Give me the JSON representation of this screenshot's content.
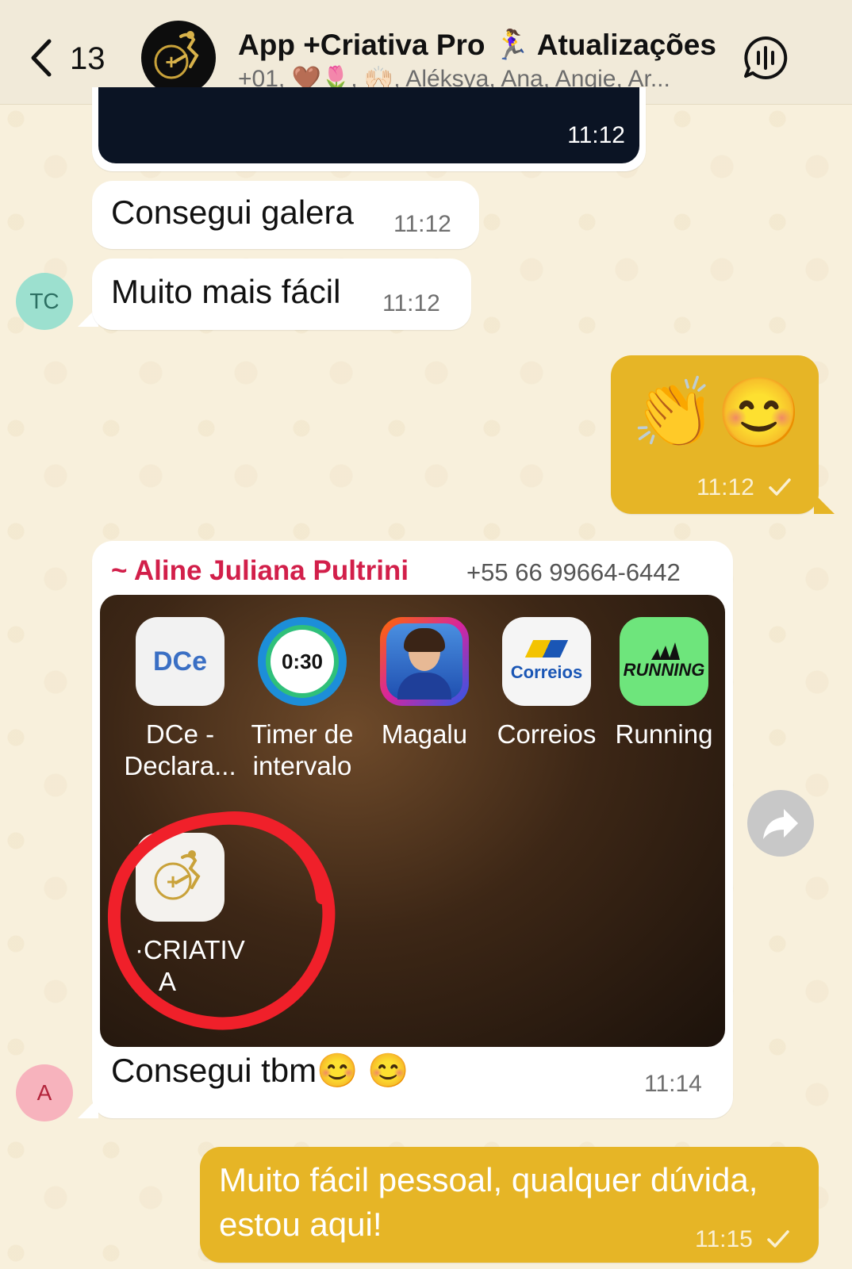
{
  "header": {
    "back_count": "13",
    "title": "App +Criativa Pro 🏃‍♀️ Atualizações",
    "subtitle": "+01, 🤎🌷, 🙌🏻, Aléksya, Ana, Angie, Ar..."
  },
  "messages": {
    "m0_time": "11:12",
    "m1_text": "Consegui galera",
    "m1_time": "11:12",
    "m2_text": "Muito mais fácil",
    "m2_time": "11:12",
    "m2_avatar": "TC",
    "m3_emoji": "👏😊",
    "m3_time": "11:12",
    "m4_sender": "~ Aline Juliana Pultrini",
    "m4_phone": "+55 66 99664-6442",
    "m4_text": "Consegui tbm😊 😊",
    "m4_time": "11:14",
    "m4_avatar": "A",
    "m5_line1": "Muito fácil pessoal, qualquer dúvida,",
    "m5_line2": "estou aqui!",
    "m5_time": "11:15"
  },
  "screenshot_apps": [
    {
      "label1": "DCe -",
      "label2": "Declara...",
      "icon_text": "DCe"
    },
    {
      "label1": "Timer de",
      "label2": "intervalo",
      "icon_text": "0:30"
    },
    {
      "label1": "Magalu",
      "label2": "",
      "icon_text": ""
    },
    {
      "label1": "Correios",
      "label2": "",
      "icon_text": "Correios"
    },
    {
      "label1": "Running",
      "label2": "",
      "icon_text": "RUNNING"
    }
  ],
  "criativa_app": {
    "label1": "·CRIATIV",
    "label2": "A"
  },
  "colors": {
    "outgoing": "#e6b526",
    "incoming": "#ffffff",
    "sender_name": "#d21f4a",
    "background": "#f8f0dc"
  }
}
